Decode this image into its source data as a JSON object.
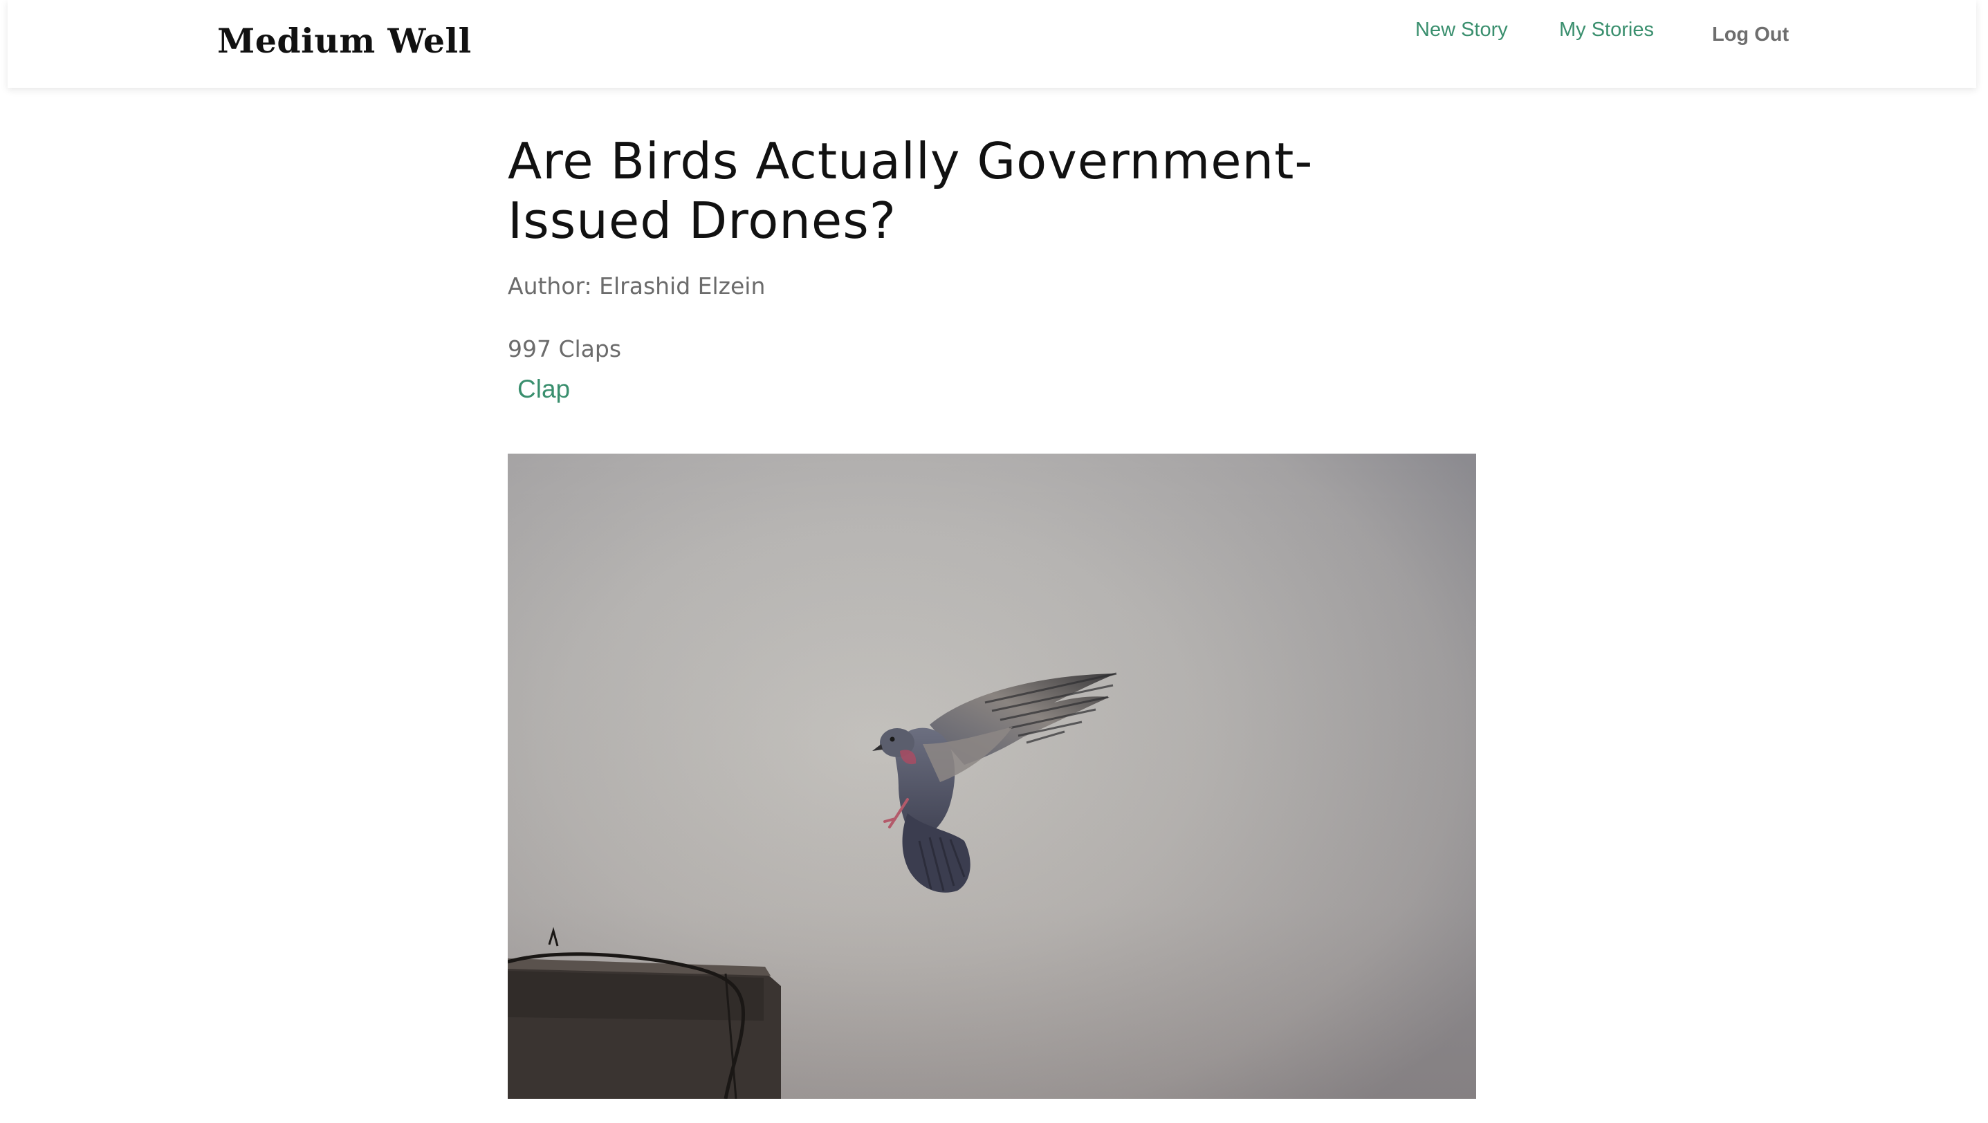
{
  "navbar": {
    "brand": "Medium Well",
    "links": {
      "new_story": "New Story",
      "my_stories": "My Stories",
      "log_out": "Log Out"
    }
  },
  "story": {
    "title": "Are Birds Actually Government-Issued Drones?",
    "author": "Author: Elrashid Elzein",
    "claps": "997 Claps",
    "clap_button": "Clap"
  },
  "image": {
    "subject": "pigeon-photo"
  },
  "colors": {
    "accent_green": "#3a8f6e",
    "muted_text": "#6b6b6b",
    "title_text": "#111111",
    "background": "#ffffff"
  }
}
